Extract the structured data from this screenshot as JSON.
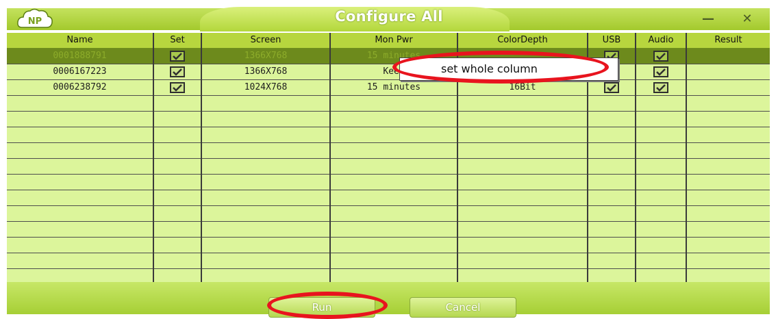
{
  "window": {
    "title": "Configure All",
    "logo_text": "NP",
    "minimize_glyph": "—",
    "close_glyph": "✕"
  },
  "table": {
    "columns": [
      "Name",
      "Set",
      "Screen",
      "Mon Pwr",
      "ColorDepth",
      "USB",
      "Audio",
      "Result"
    ],
    "rows": [
      {
        "name": "0001888791",
        "set": true,
        "screen": "1366X768",
        "mon_pwr": "15 minutes",
        "color_depth": "",
        "usb": true,
        "audio": true,
        "result": "",
        "selected": true
      },
      {
        "name": "0006167223",
        "set": true,
        "screen": "1366X768",
        "mon_pwr": "Keep",
        "color_depth": "",
        "usb": true,
        "audio": true,
        "result": "",
        "selected": false
      },
      {
        "name": "0006238792",
        "set": true,
        "screen": "1024X768",
        "mon_pwr": "15 minutes",
        "color_depth": "16Bit",
        "usb": true,
        "audio": true,
        "result": "",
        "selected": false
      }
    ],
    "empty_row_count": 12
  },
  "context_menu": {
    "items": [
      "set whole column"
    ]
  },
  "buttons": {
    "run": "Run",
    "cancel": "Cancel"
  },
  "colors": {
    "accent": "#a3c92c",
    "row_bg": "#dcf59b",
    "selected_row": "#6d8a1c",
    "annotation": "#e8141e"
  }
}
